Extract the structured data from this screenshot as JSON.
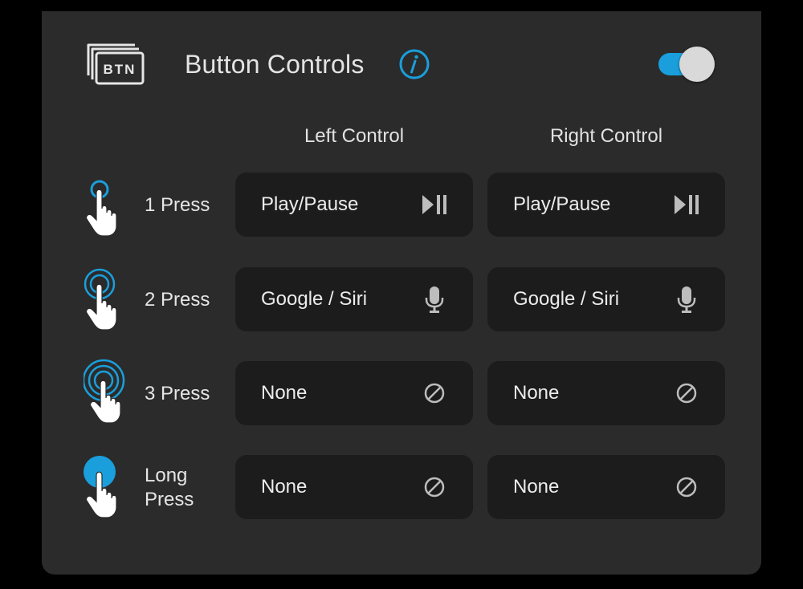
{
  "header": {
    "logo_text": "BTN",
    "title": "Button Controls",
    "info_icon": "info-icon",
    "toggle_on": true,
    "accent_color": "#1a9fdc"
  },
  "columns": [
    "Left Control",
    "Right Control"
  ],
  "rows": [
    {
      "label": "1 Press",
      "icon": "single-tap-hand-icon",
      "left": {
        "text": "Play/Pause",
        "icon": "play-pause-icon"
      },
      "right": {
        "text": "Play/Pause",
        "icon": "play-pause-icon"
      }
    },
    {
      "label": "2 Press",
      "icon": "double-tap-hand-icon",
      "left": {
        "text": "Google / Siri",
        "icon": "microphone-icon"
      },
      "right": {
        "text": "Google / Siri",
        "icon": "microphone-icon"
      }
    },
    {
      "label": "3 Press",
      "icon": "triple-tap-hand-icon",
      "left": {
        "text": "None",
        "icon": "none-icon"
      },
      "right": {
        "text": "None",
        "icon": "none-icon"
      }
    },
    {
      "label": "Long Press",
      "label_lines": [
        "Long",
        "Press"
      ],
      "icon": "long-press-hand-icon",
      "left": {
        "text": "None",
        "icon": "none-icon"
      },
      "right": {
        "text": "None",
        "icon": "none-icon"
      }
    }
  ]
}
